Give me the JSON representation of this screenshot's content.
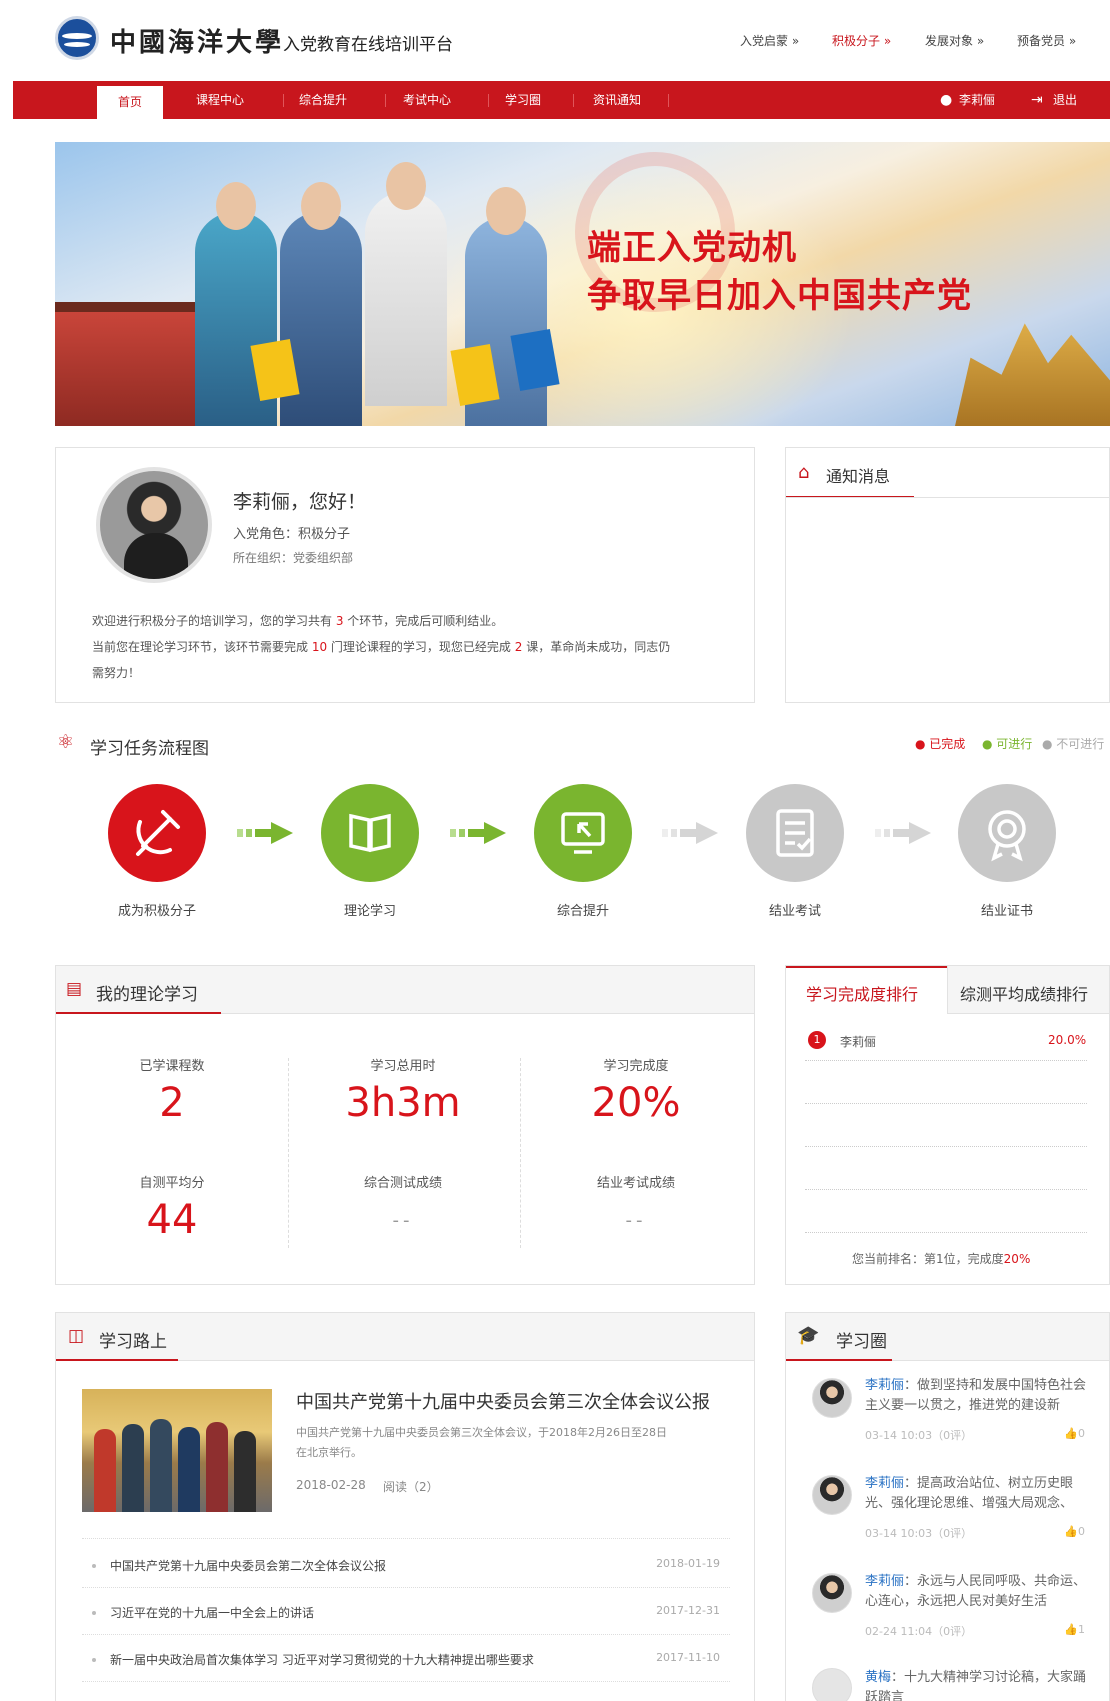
{
  "header": {
    "logo_text": "中國海洋大學",
    "platform_name": "入党教育在线培训平台",
    "top_links": [
      "入党启蒙 »",
      "积极分子 »",
      "发展对象 »",
      "预备党员 »"
    ]
  },
  "nav": {
    "items": [
      "首页",
      "课程中心",
      "综合提升",
      "考试中心",
      "学习圈",
      "资讯通知"
    ],
    "user": "李莉俪",
    "logout": "退出"
  },
  "banner": {
    "slogan_line1": "端正入党动机",
    "slogan_line2": "争取早日加入中国共产党"
  },
  "profile": {
    "greeting": "李莉俪，您好！",
    "role": "入党角色：积极分子",
    "org": "所在组织：党委组织部",
    "msg1_a": "欢迎进行积极分子的培训学习，您的学习共有 ",
    "msg1_num": "3",
    "msg1_b": " 个环节，完成后可顺利结业。",
    "msg2_a": "当前您在理论学习环节，该环节需要完成 ",
    "msg2_num1": "10",
    "msg2_b": " 门理论课程的学习，现您已经完成 ",
    "msg2_num2": "2",
    "msg2_c": " 课，革命尚未成功，同志仍",
    "msg2_d": "需努力！"
  },
  "notice": {
    "title": "通知消息"
  },
  "flow": {
    "title": "学习任务流程图",
    "legend": [
      "● 已完成",
      "● 可进行",
      "● 不可进行"
    ],
    "steps": [
      "成为积极分子",
      "理论学习",
      "综合提升",
      "结业考试",
      "结业证书"
    ],
    "colors": {
      "done": "#d8141b",
      "available": "#7ab52f",
      "locked": "#c8c8c8"
    }
  },
  "theory": {
    "title": "我的理论学习",
    "stats": [
      {
        "label": "已学课程数",
        "value": "2"
      },
      {
        "label": "学习总用时",
        "value": "3h3m"
      },
      {
        "label": "学习完成度",
        "value": "20%"
      },
      {
        "label": "自测平均分",
        "value": "44"
      },
      {
        "label": "综合测试成绩",
        "value": "--"
      },
      {
        "label": "结业考试成绩",
        "value": "--"
      }
    ]
  },
  "ranking": {
    "tabs": [
      "学习完成度排行",
      "综测平均成绩排行"
    ],
    "rows": [
      {
        "rank": "1",
        "name": "李莉俪",
        "value": "20.0%"
      }
    ],
    "footer_a": "您当前排名：第",
    "footer_rank": "1",
    "footer_b": "位，完成度",
    "footer_pct": "20%"
  },
  "road": {
    "title": "学习路上",
    "featured": {
      "title": "中国共产党第十九届中央委员会第三次全体会议公报",
      "summary1": "中国共产党第十九届中央委员会第三次全体会议，于2018年2月26日至28日",
      "summary2": "在北京举行。",
      "date": "2018-02-28",
      "reads": "阅读（2）"
    },
    "items": [
      {
        "title": "中国共产党第十九届中央委员会第二次全体会议公报",
        "date": "2018-01-19"
      },
      {
        "title": "习近平在党的十九届一中全会上的讲话",
        "date": "2017-12-31"
      },
      {
        "title": "新一届中央政治局首次集体学习 习近平对学习贯彻党的十九大精神提出哪些要求",
        "date": "2017-11-10"
      }
    ]
  },
  "circle": {
    "title": "学习圈",
    "posts": [
      {
        "user": "李莉俪",
        "text": "：做到坚持和发展中国特色社会主义要一以贯之，推进党的建设新",
        "meta": "03-14 10:03（0评）",
        "likes": "0"
      },
      {
        "user": "李莉俪",
        "text": "：提高政治站位、树立历史眼光、强化理论思维、增强大局观念、",
        "meta": "03-14 10:03（0评）",
        "likes": "0"
      },
      {
        "user": "李莉俪",
        "text": "：永远与人民同呼吸、共命运、心连心，永远把人民对美好生活",
        "meta": "02-24 11:04（0评）",
        "likes": "1"
      },
      {
        "user": "黄梅",
        "text": "：十九大精神学习讨论稿，大家踊跃踏言",
        "meta": "",
        "likes": ""
      }
    ]
  }
}
